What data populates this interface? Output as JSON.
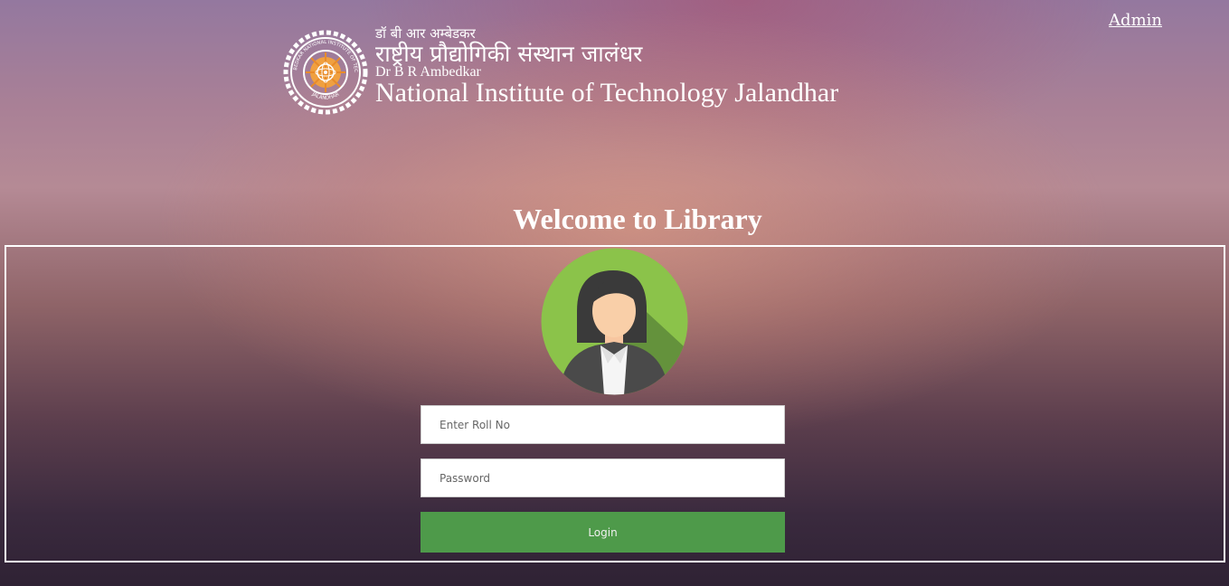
{
  "header": {
    "admin_link": "Admin",
    "hindi_line1": "डॉ बी आर अम्बेडकर",
    "hindi_line2": "राष्ट्रीय प्रौद्योगिकी संस्थान जालंधर",
    "english_line1": "Dr B R Ambedkar",
    "english_line2": "National Institute of Technology Jalandhar"
  },
  "main": {
    "welcome_title": "Welcome to Library"
  },
  "login_form": {
    "roll_placeholder": "Enter Roll No",
    "password_placeholder": "Password",
    "login_label": "Login"
  },
  "logo": {
    "ring_top_text": "DR B R AMBEDKAR NATIONAL INSTITUTE OF TECHNOLOGY",
    "ring_bottom_text": "JALANDHAR"
  },
  "colors": {
    "login_button": "#4e9a4a",
    "avatar_bg": "#8bc34a",
    "text": "#ffffff"
  },
  "icons": {
    "logo": "institute-seal",
    "avatar": "user-avatar-female"
  }
}
